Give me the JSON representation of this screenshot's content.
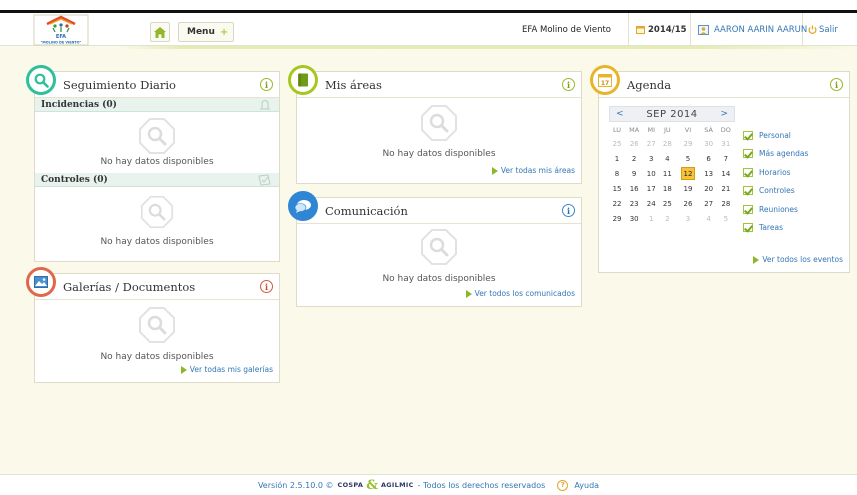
{
  "header": {
    "logo_text": "EFA",
    "logo_subtext": "\"MOLINO DE VIENTO\"",
    "menu_label": "Menu",
    "menu_plus": "+",
    "school_name": "EFA Molino de Viento",
    "school_year": "2014/15",
    "user_name": "AARON AARIN AARUN",
    "exit_label": "Salir"
  },
  "panels": {
    "seguimiento": {
      "title": "Seguimiento Diario",
      "info": "i",
      "incidencias_label": "Incidencias (0)",
      "incidencias_empty": "No hay datos disponibles",
      "controles_label": "Controles (0)",
      "controles_empty": "No hay datos disponibles"
    },
    "galerias": {
      "title": "Galerías / Documentos",
      "info": "i",
      "empty": "No hay datos disponibles",
      "link": "Ver todas mis galerías"
    },
    "areas": {
      "title": "Mis áreas",
      "info": "i",
      "empty": "No hay datos disponibles",
      "link": "Ver todas mis áreas"
    },
    "comunicacion": {
      "title": "Comunicación",
      "info": "i",
      "empty": "No hay datos disponibles",
      "link": "Ver todos los comunicados"
    },
    "agenda": {
      "title": "Agenda",
      "info": "i",
      "icon_day": "17",
      "month_label": "SEP 2014",
      "prev": "<",
      "next": ">",
      "weekdays": [
        "LU",
        "MA",
        "MI",
        "JU",
        "VI",
        "SÁ",
        "DO"
      ],
      "weeks": [
        [
          {
            "d": "25",
            "m": true
          },
          {
            "d": "26",
            "m": true
          },
          {
            "d": "27",
            "m": true
          },
          {
            "d": "28",
            "m": true
          },
          {
            "d": "29",
            "m": true
          },
          {
            "d": "30",
            "m": true
          },
          {
            "d": "31",
            "m": true
          }
        ],
        [
          {
            "d": "1"
          },
          {
            "d": "2"
          },
          {
            "d": "3"
          },
          {
            "d": "4"
          },
          {
            "d": "5"
          },
          {
            "d": "6"
          },
          {
            "d": "7"
          }
        ],
        [
          {
            "d": "8"
          },
          {
            "d": "9"
          },
          {
            "d": "10"
          },
          {
            "d": "11"
          },
          {
            "d": "12",
            "t": true
          },
          {
            "d": "13"
          },
          {
            "d": "14"
          }
        ],
        [
          {
            "d": "15"
          },
          {
            "d": "16"
          },
          {
            "d": "17"
          },
          {
            "d": "18"
          },
          {
            "d": "19"
          },
          {
            "d": "20"
          },
          {
            "d": "21"
          }
        ],
        [
          {
            "d": "22"
          },
          {
            "d": "23"
          },
          {
            "d": "24"
          },
          {
            "d": "25"
          },
          {
            "d": "26"
          },
          {
            "d": "27"
          },
          {
            "d": "28"
          }
        ],
        [
          {
            "d": "29"
          },
          {
            "d": "30"
          },
          {
            "d": "1",
            "m": true
          },
          {
            "d": "2",
            "m": true
          },
          {
            "d": "3",
            "m": true
          },
          {
            "d": "4",
            "m": true
          },
          {
            "d": "5",
            "m": true
          }
        ]
      ],
      "legend": [
        "Personal",
        "Más agendas",
        "Horarios",
        "Controles",
        "Reuniones",
        "Tareas"
      ],
      "link": "Ver todos los eventos"
    }
  },
  "footer": {
    "version": "Versión 2.5.10.0 ©",
    "brand1": "COSPA",
    "amp": "&",
    "brand2": "AGILMIC",
    "rights": "- Todos los derechos reservados",
    "help_icon": "?",
    "help": "Ayuda"
  },
  "colors": {
    "green_accent": "#2fbf9a",
    "lime_accent": "#a8c620",
    "blue_accent": "#2f86d4",
    "red_accent": "#e0684a",
    "yellow_accent": "#e8b52a",
    "link": "#3477b5"
  }
}
